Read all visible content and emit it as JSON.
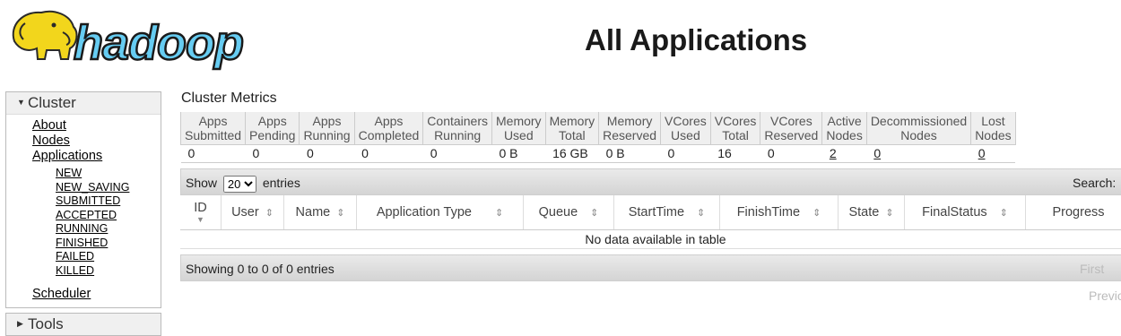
{
  "header": {
    "logo_text": "hadoop",
    "title": "All Applications"
  },
  "sidebar": {
    "cluster": {
      "label": "Cluster",
      "links": [
        "About",
        "Nodes",
        "Applications"
      ],
      "app_states": [
        "NEW",
        "NEW_SAVING",
        "SUBMITTED",
        "ACCEPTED",
        "RUNNING",
        "FINISHED",
        "FAILED",
        "KILLED"
      ],
      "scheduler": "Scheduler"
    },
    "tools": {
      "label": "Tools"
    }
  },
  "metrics": {
    "title": "Cluster Metrics",
    "columns": [
      {
        "h1": "Apps",
        "h2": "Submitted",
        "value": "0",
        "link": false
      },
      {
        "h1": "Apps",
        "h2": "Pending",
        "value": "0",
        "link": false
      },
      {
        "h1": "Apps",
        "h2": "Running",
        "value": "0",
        "link": false
      },
      {
        "h1": "Apps",
        "h2": "Completed",
        "value": "0",
        "link": false
      },
      {
        "h1": "Containers",
        "h2": "Running",
        "value": "0",
        "link": false
      },
      {
        "h1": "Memory",
        "h2": "Used",
        "value": "0 B",
        "link": false
      },
      {
        "h1": "Memory",
        "h2": "Total",
        "value": "16 GB",
        "link": false
      },
      {
        "h1": "Memory",
        "h2": "Reserved",
        "value": "0 B",
        "link": false
      },
      {
        "h1": "VCores",
        "h2": "Used",
        "value": "0",
        "link": false
      },
      {
        "h1": "VCores",
        "h2": "Total",
        "value": "16",
        "link": false
      },
      {
        "h1": "VCores",
        "h2": "Reserved",
        "value": "0",
        "link": false
      },
      {
        "h1": "Active",
        "h2": "Nodes",
        "value": "2",
        "link": true
      },
      {
        "h1": "Decommissioned",
        "h2": "Nodes",
        "value": "0",
        "link": true
      },
      {
        "h1": "Lost",
        "h2": "Nodes",
        "value": "0",
        "link": true
      }
    ]
  },
  "apps": {
    "show_label": "Show",
    "page_size": "20",
    "entries_label": "entries",
    "search_label": "Search:",
    "columns": [
      "ID",
      "User",
      "Name",
      "Application Type",
      "Queue",
      "StartTime",
      "FinishTime",
      "State",
      "FinalStatus",
      "Progress"
    ],
    "empty_text": "No data available in table",
    "info_text": "Showing 0 to 0 of 0 entries",
    "pager": {
      "first": "First",
      "previous": "Previous"
    }
  },
  "icons": {
    "sort": "sort-both-icon",
    "sort_desc": "sort-desc-icon",
    "expand": "triangle-down-icon",
    "collapse": "triangle-right-icon"
  }
}
